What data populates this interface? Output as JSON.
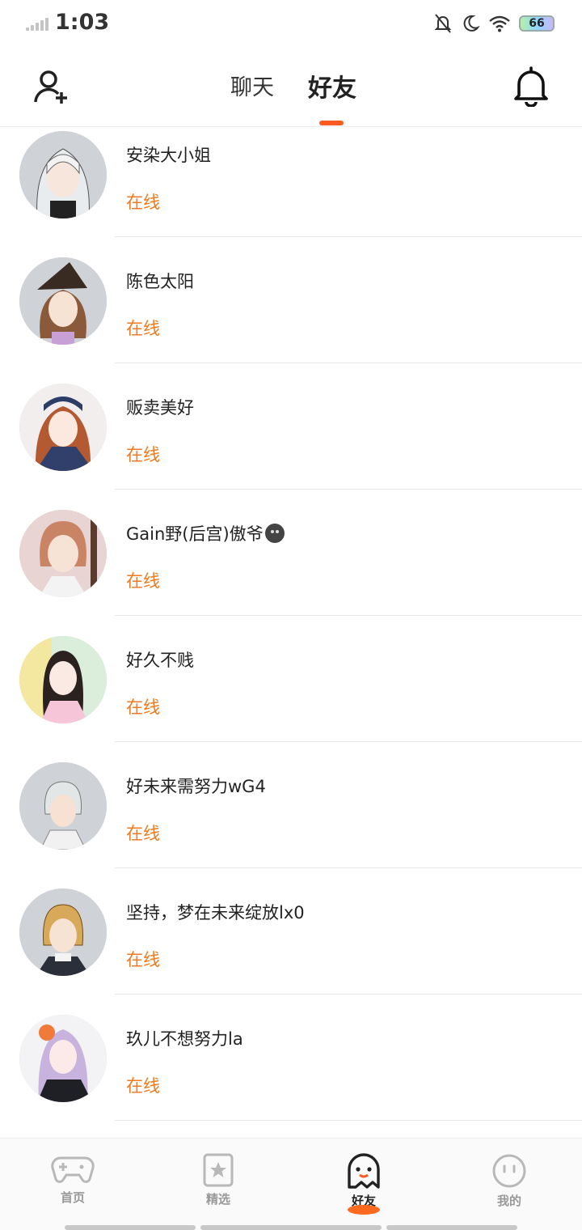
{
  "status_bar": {
    "time": "1:03",
    "battery": "66"
  },
  "header": {
    "tabs": [
      {
        "label": "聊天",
        "active": false
      },
      {
        "label": "好友",
        "active": true
      }
    ],
    "accent_color": "#ff5a1f"
  },
  "friends": [
    {
      "name": "安染大小姐",
      "status": "在线",
      "avatar": "avatar-silver-hair"
    },
    {
      "name": "陈色太阳",
      "status": "在线",
      "avatar": "avatar-witch-hat"
    },
    {
      "name": "贩卖美好",
      "status": "在线",
      "avatar": "avatar-headphones"
    },
    {
      "name": "Gain野(后宫)傲爷",
      "status": "在线",
      "avatar": "avatar-guitar",
      "emoji": "dark-smiley"
    },
    {
      "name": "好久不贱",
      "status": "在线",
      "avatar": "avatar-pink-hoodie"
    },
    {
      "name": "好未来需努力wG4",
      "status": "在线",
      "avatar": "avatar-grey-hair"
    },
    {
      "name": "坚持，梦在未来绽放lx0",
      "status": "在线",
      "avatar": "avatar-blonde-boy"
    },
    {
      "name": "玖儿不想努力la",
      "status": "在线",
      "avatar": "avatar-lavender-hair"
    }
  ],
  "status_color": "#f07a20",
  "bottom_nav": [
    {
      "label": "首页",
      "icon": "gamepad-icon",
      "active": false
    },
    {
      "label": "精选",
      "icon": "star-bookmark-icon",
      "active": false
    },
    {
      "label": "好友",
      "icon": "ghost-icon",
      "active": true
    },
    {
      "label": "我的",
      "icon": "face-icon",
      "active": false
    }
  ]
}
